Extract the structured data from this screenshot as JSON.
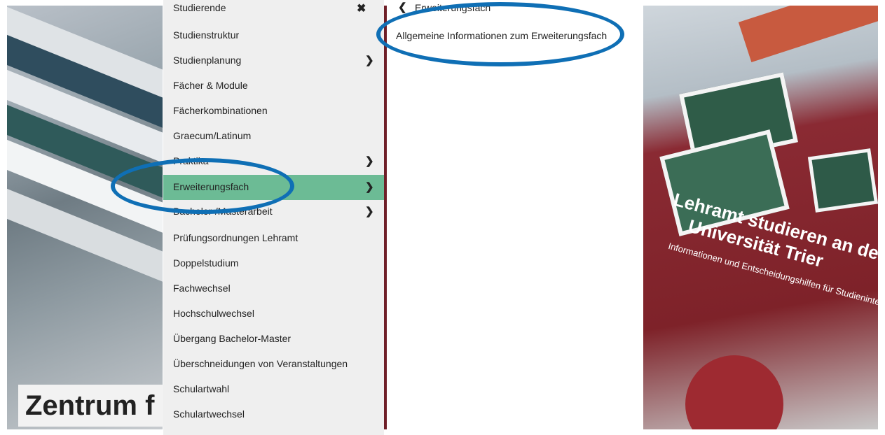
{
  "background": {
    "headline": "Zentrum f",
    "brochure_title_line1": "Lehramt studieren an der",
    "brochure_title_line2": "Universität Trier",
    "brochure_subtitle": "Informationen und Entscheidungshilfen für Studieninteressierte"
  },
  "menu": {
    "title": "Studierende",
    "close_icon": "close-icon",
    "items": [
      {
        "label": "Studienstruktur",
        "has_submenu": false
      },
      {
        "label": "Studienplanung",
        "has_submenu": true
      },
      {
        "label": "Fächer & Module",
        "has_submenu": false
      },
      {
        "label": "Fächerkombinationen",
        "has_submenu": false
      },
      {
        "label": "Graecum/Latinum",
        "has_submenu": false
      },
      {
        "label": "Praktika",
        "has_submenu": true
      },
      {
        "label": "Erweiterungsfach",
        "has_submenu": true,
        "active": true
      },
      {
        "label": "Bachelor-/Masterarbeit",
        "has_submenu": true
      },
      {
        "label": "Prüfungsordnungen Lehramt",
        "has_submenu": false
      },
      {
        "label": "Doppelstudium",
        "has_submenu": false
      },
      {
        "label": "Fachwechsel",
        "has_submenu": false
      },
      {
        "label": "Hochschulwechsel",
        "has_submenu": false
      },
      {
        "label": "Übergang Bachelor-Master",
        "has_submenu": false
      },
      {
        "label": "Überschneidungen von Veranstaltungen",
        "has_submenu": false
      },
      {
        "label": "Schulartwahl",
        "has_submenu": false
      },
      {
        "label": "Schulartwechsel",
        "has_submenu": false
      }
    ],
    "active_color": "#6cbb95"
  },
  "submenu": {
    "back_icon": "chevron-left-icon",
    "title": "Erweiterungsfach",
    "items": [
      {
        "label": "Allgemeine Informationen zum Erweiterungsfach"
      }
    ]
  },
  "annotation_color": "#0f6fb5",
  "glyphs": {
    "chevron_right": "❯",
    "chevron_left": "❮",
    "close": "✖"
  }
}
